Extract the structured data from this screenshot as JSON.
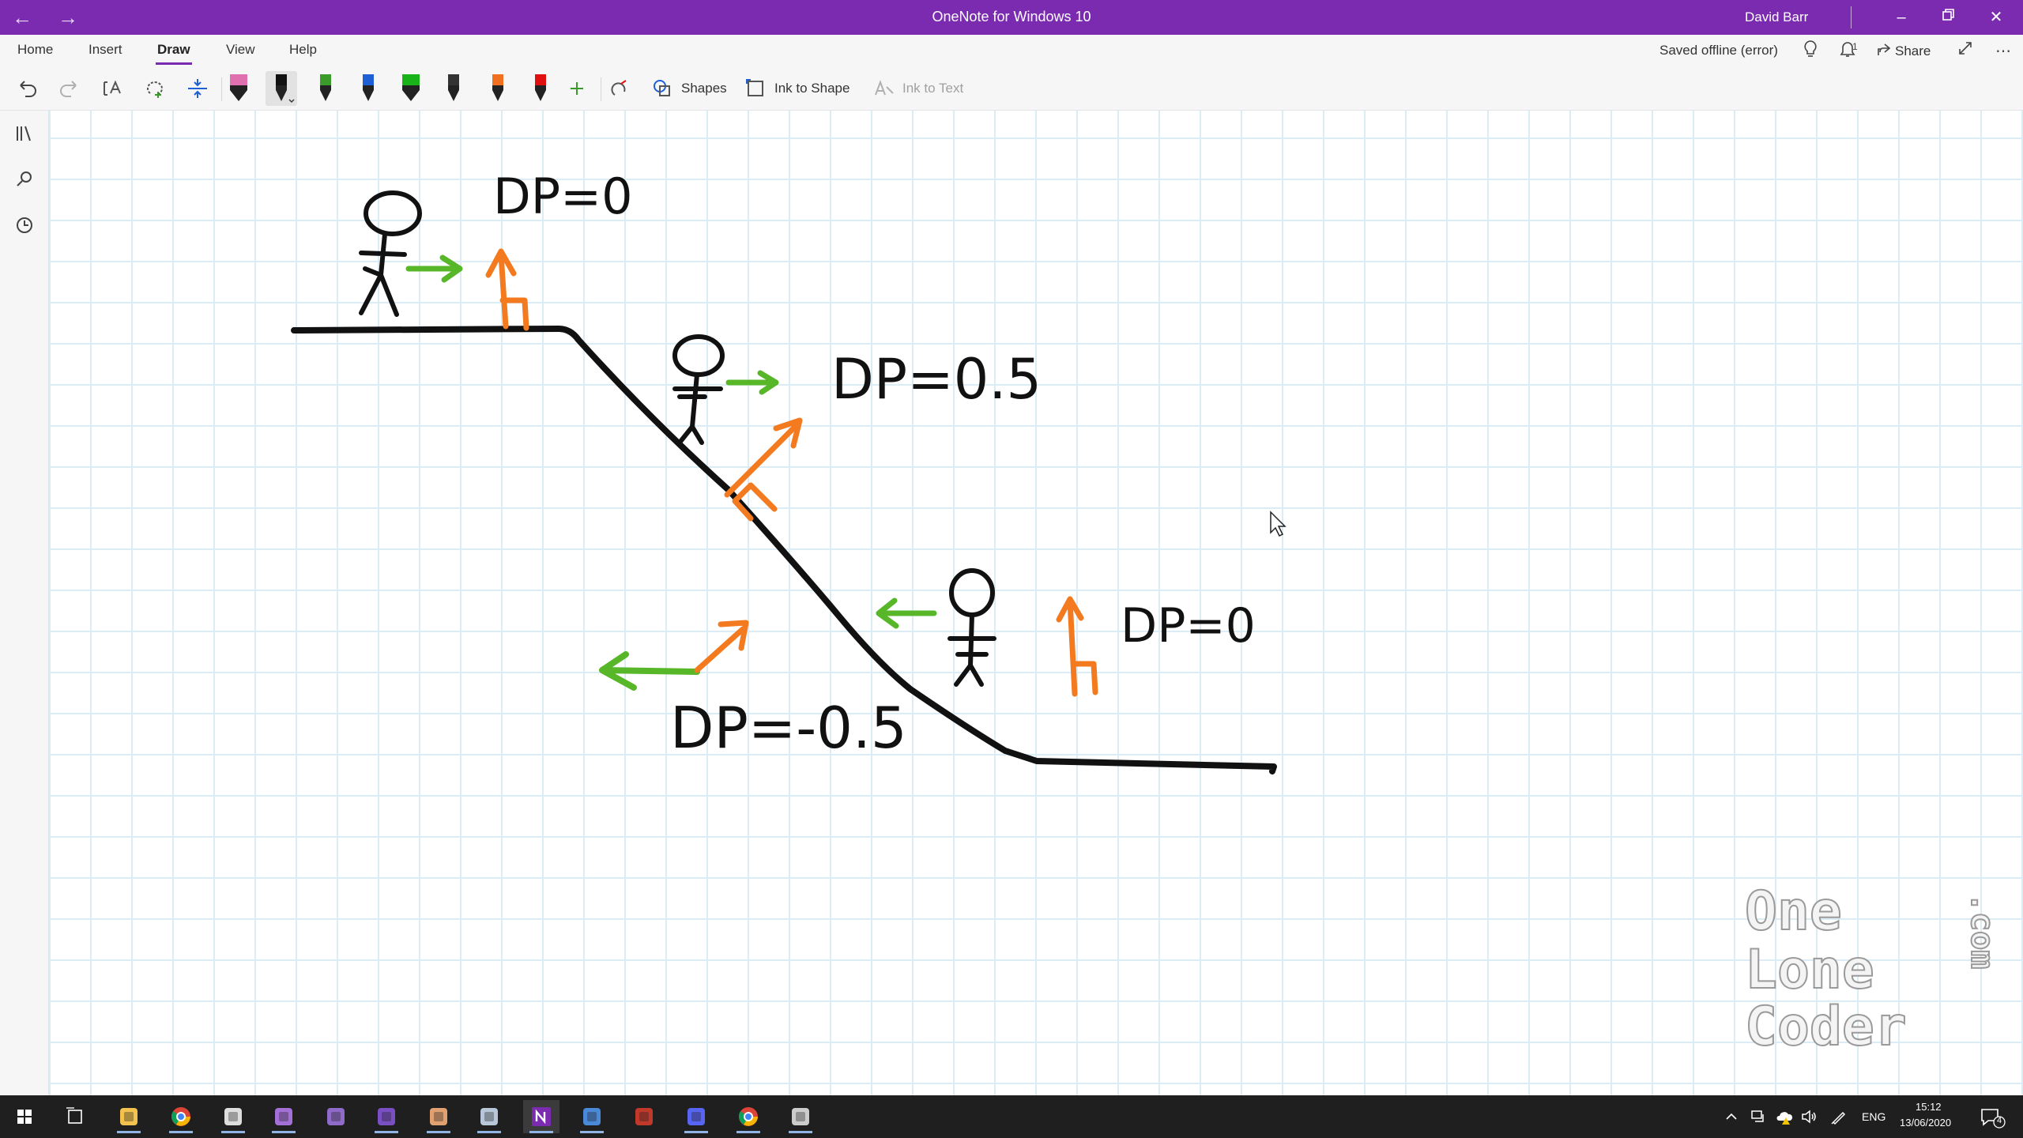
{
  "window": {
    "title": "OneNote for Windows 10",
    "user": "David Barr"
  },
  "menu": {
    "tabs": [
      "Home",
      "Insert",
      "Draw",
      "View",
      "Help"
    ],
    "active_tab": "Draw",
    "status": "Saved offline (error)",
    "share_label": "Share",
    "notification_count": "1"
  },
  "toolbar": {
    "shapes_label": "Shapes",
    "ink_to_shape_label": "Ink to Shape",
    "ink_to_text_label": "Ink to Text",
    "pens": [
      {
        "name": "highlighter-pink",
        "color": "#e070b0"
      },
      {
        "name": "pen-black-selected",
        "color": "#111111"
      },
      {
        "name": "pen-green",
        "color": "#3a9a2a"
      },
      {
        "name": "pen-blue",
        "color": "#1f5fd6"
      },
      {
        "name": "pen-bright-green",
        "color": "#19b319"
      },
      {
        "name": "pencil-black",
        "color": "#333333"
      },
      {
        "name": "pen-orange",
        "color": "#f07020"
      },
      {
        "name": "pen-red",
        "color": "#e01010"
      }
    ]
  },
  "drawing": {
    "labels": {
      "top": "DP=0",
      "middle": "DP=0.5",
      "bottom_right": "DP=0",
      "bottom_left": "DP=-0.5"
    },
    "colors": {
      "ink": "#111111",
      "green": "#57b728",
      "orange": "#f37a1e"
    }
  },
  "watermark": {
    "lines": [
      "One",
      "Lone",
      "Coder"
    ],
    "suffix": ".com"
  },
  "taskbar": {
    "apps": [
      "windows-start",
      "task-view",
      "file-explorer",
      "chrome",
      "bug-app",
      "visual-studio",
      "visual-studio-preview",
      "visual-studio-2",
      "paint-app",
      "palette-app",
      "onenote",
      "remote-desktop",
      "film-app",
      "discord",
      "chrome-profile",
      "obs-studio"
    ],
    "language": "ENG",
    "time": "15:12",
    "date": "13/06/2020",
    "notification_count": "4"
  },
  "accent": "#7b2bb0"
}
